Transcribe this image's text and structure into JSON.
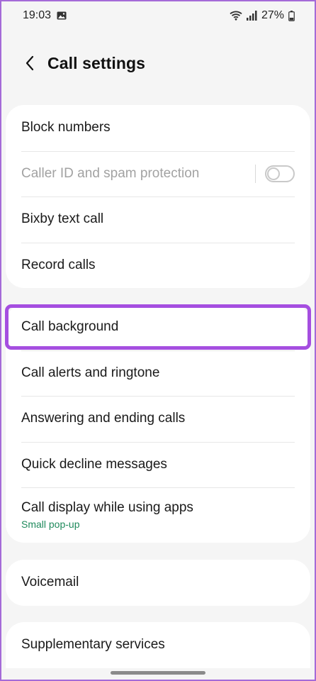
{
  "status_bar": {
    "time": "19:03",
    "battery": "27%",
    "icons": [
      "gallery-icon",
      "wifi-icon",
      "signal-icon",
      "battery-icon"
    ]
  },
  "header": {
    "back_icon": "chevron-left-icon",
    "title": "Call settings"
  },
  "groups": [
    {
      "items": [
        {
          "label": "Block numbers"
        },
        {
          "label": "Caller ID and spam protection",
          "disabled": true,
          "toggle": "off"
        },
        {
          "label": "Bixby text call"
        },
        {
          "label": "Record calls"
        }
      ]
    },
    {
      "items": [
        {
          "label": "Call background",
          "highlighted": true
        },
        {
          "label": "Call alerts and ringtone"
        },
        {
          "label": "Answering and ending calls"
        },
        {
          "label": "Quick decline messages"
        },
        {
          "label": "Call display while using apps",
          "sublabel": "Small pop-up"
        }
      ]
    },
    {
      "items": [
        {
          "label": "Voicemail"
        }
      ]
    },
    {
      "items": [
        {
          "label": "Supplementary services"
        }
      ]
    }
  ],
  "colors": {
    "highlight": "#a54ee0",
    "sublabel": "#1f8a5c",
    "background": "#f5f5f5"
  }
}
